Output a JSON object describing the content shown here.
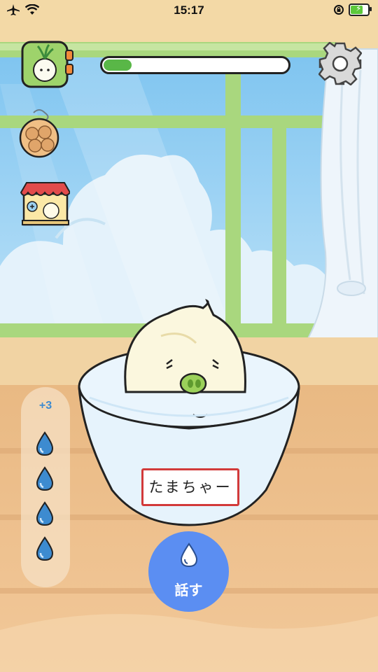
{
  "status_bar": {
    "time": "15:17",
    "left_icons": [
      "airplane-icon",
      "wifi-icon"
    ],
    "right_icons": [
      "rotation-lock-icon",
      "battery-icon"
    ],
    "battery_level": 0.8,
    "charging": true
  },
  "progress": {
    "value": 0.15,
    "fill_color": "#59b747"
  },
  "side_menu": [
    {
      "name": "onion-character-menu",
      "icon": "green-onion-card-icon"
    },
    {
      "name": "bag-items-menu",
      "icon": "onion-bag-icon"
    },
    {
      "name": "shop-menu",
      "icon": "shop-stall-icon"
    }
  ],
  "settings_icon": "gear-icon",
  "drops": {
    "count_label": "+3",
    "items": 4,
    "color": "#3d8bd0"
  },
  "character": {
    "name_tag": "たまちゃー"
  },
  "talk_button": {
    "label": "話す",
    "color": "#5b8ef2"
  }
}
